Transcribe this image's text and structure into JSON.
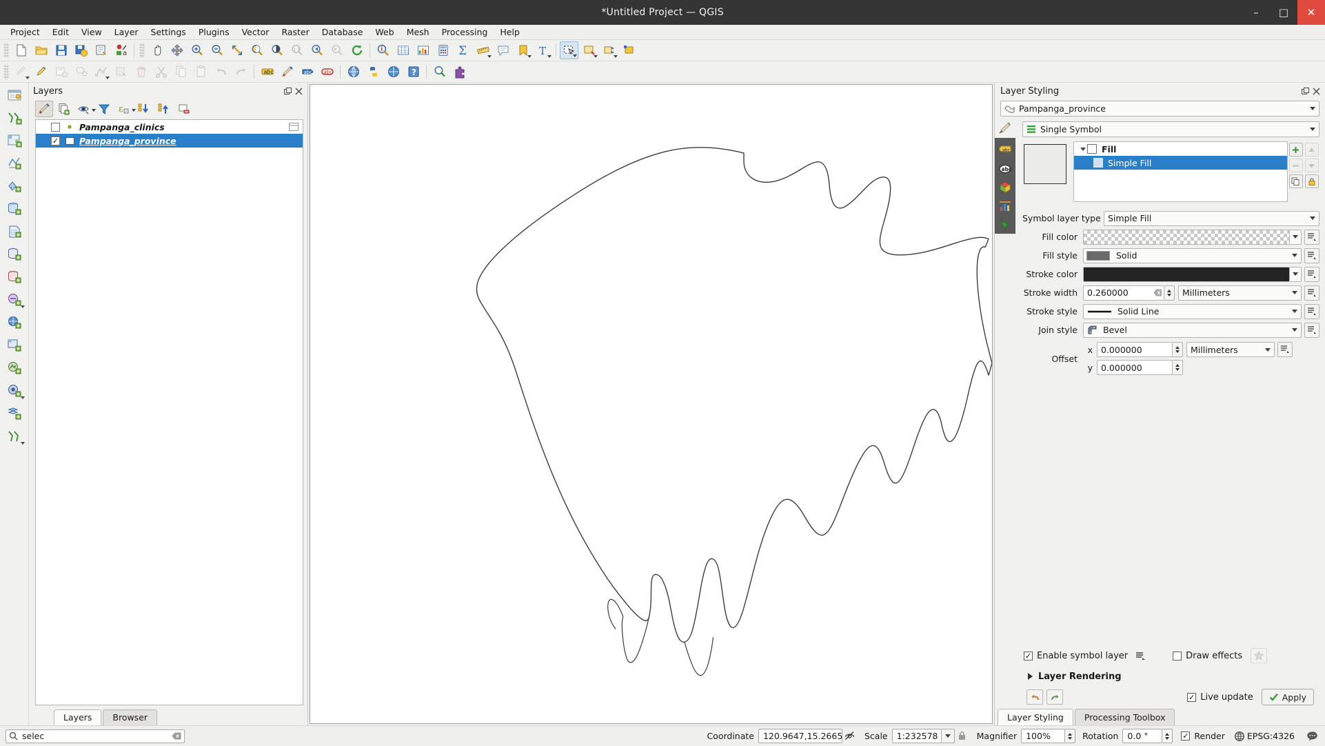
{
  "window": {
    "title": "*Untitled Project — QGIS",
    "minimize": "–",
    "maximize": "□",
    "close": "✕"
  },
  "menubar": {
    "items": [
      {
        "label": "Project"
      },
      {
        "label": "Edit"
      },
      {
        "label": "View"
      },
      {
        "label": "Layer"
      },
      {
        "label": "Settings"
      },
      {
        "label": "Plugins"
      },
      {
        "label": "Vector"
      },
      {
        "label": "Raster"
      },
      {
        "label": "Database"
      },
      {
        "label": "Web"
      },
      {
        "label": "Mesh"
      },
      {
        "label": "Processing"
      },
      {
        "label": "Help"
      }
    ]
  },
  "toolbar_row1": {
    "icons": [
      "new-project-icon",
      "open-project-icon",
      "save-project-icon",
      "save-project-as-icon",
      "new-print-layout-icon",
      "style-manager-icon",
      "pan-map-icon",
      "pan-to-selection-icon",
      "zoom-in-icon",
      "zoom-out-icon",
      "zoom-full-icon",
      "zoom-to-selection-icon",
      "zoom-to-layer-icon",
      "zoom-native-icon",
      "zoom-last-icon",
      "zoom-next-icon",
      "refresh-icon",
      "identify-features-icon",
      "open-attribute-table-icon",
      "statistical-summary-icon",
      "field-calculator-icon",
      "sum-icon",
      "measure-line-icon",
      "map-tips-icon",
      "new-bookmark-icon",
      "text-annotation-icon",
      "select-features-icon",
      "deselect-features-icon",
      "select-value-icon",
      "new-spatial-bookmark-icon"
    ]
  },
  "toolbar_row2": {
    "icons": [
      "current-edits-icon",
      "toggle-editing-icon",
      "save-layer-edits-icon",
      "add-feature-icon",
      "vertex-tool-icon",
      "modify-attributes-icon",
      "delete-selected-icon",
      "cut-features-icon",
      "copy-features-icon",
      "paste-features-icon",
      "undo-icon",
      "redo-icon",
      "label-icon",
      "styling-icon",
      "show-labels-icon",
      "show-pinned-labels-icon",
      "map-globe-icon",
      "python-console-icon",
      "html-help-icon",
      "help-icon",
      "locator-icon",
      "plugin-icon"
    ]
  },
  "left_rail": {
    "icons": [
      "open-data-source-manager-icon",
      "add-vector-layer-icon",
      "add-raster-layer-icon",
      "add-mesh-layer-icon",
      "add-delimited-text-layer-icon",
      "add-postgis-layer-icon",
      "add-spatialite-layer-icon",
      "add-mssql-layer-icon",
      "add-oracle-layer-icon",
      "add-db2-layer-icon",
      "add-wms-layer-icon",
      "add-wcs-layer-icon",
      "add-wfs-layer-icon",
      "add-arcgis-mapserver-layer-icon",
      "add-arcgis-featureserver-layer-icon",
      "add-vectortile-layer-icon",
      "new-shapefile-layer-icon"
    ]
  },
  "layers_panel": {
    "title": "Layers",
    "float_button": "float-panel-icon",
    "close_button": "close-panel-icon",
    "toolbar_icons": [
      "open-layer-styling-panel-icon",
      "add-group-icon",
      "manage-layer-visibility-icon",
      "filter-legend-icon",
      "expression-filter-icon",
      "expand-all-icon",
      "collapse-all-icon",
      "remove-layer-icon"
    ],
    "layers": [
      {
        "name": "Pampanga_clinics",
        "checked": false,
        "selected": false,
        "symbol": "point-symbol",
        "symbol_color": "#8aa32b"
      },
      {
        "name": "Pampanga_province",
        "checked": true,
        "selected": true,
        "symbol": "polygon-symbol",
        "symbol_color": "#ffffff"
      }
    ],
    "tabs": [
      {
        "label": "Layers",
        "selected": true
      },
      {
        "label": "Browser",
        "selected": false
      }
    ]
  },
  "layer_styling": {
    "title": "Layer Styling",
    "float_button": "float-panel-icon",
    "close_button": "close-panel-icon",
    "layer_selector": {
      "value": "Pampanga_province",
      "icon": "polygon-layer-icon"
    },
    "renderer_selector": {
      "value": "Single Symbol",
      "icon": "single-symbol-icon"
    },
    "rail_icons": [
      "symbology-icon",
      "labels-icon",
      "masks-icon",
      "3d-view-icon",
      "diagrams-icon",
      "actions-icon"
    ],
    "symbol_tree": [
      {
        "label": "Fill",
        "level": 0,
        "bold": true,
        "selected": false,
        "expander": true
      },
      {
        "label": "Simple Fill",
        "level": 1,
        "bold": false,
        "selected": true,
        "expander": false
      }
    ],
    "tree_side_buttons": [
      "add-symbol-layer-icon",
      "move-up-icon",
      "remove-symbol-layer-icon",
      "move-down-icon",
      "duplicate-icon",
      "lock-icon"
    ],
    "properties": {
      "symbol_layer_type": {
        "label": "Symbol layer type",
        "value": "Simple Fill"
      },
      "fill_color": {
        "label": "Fill color",
        "value": "transparent",
        "swatch": "checker"
      },
      "fill_style": {
        "label": "Fill style",
        "value": "Solid",
        "swatch": "#696969"
      },
      "stroke_color": {
        "label": "Stroke color",
        "value": "#232323"
      },
      "stroke_width": {
        "label": "Stroke width",
        "value": "0.260000",
        "unit": "Millimeters"
      },
      "stroke_style": {
        "label": "Stroke style",
        "value": "Solid Line"
      },
      "join_style": {
        "label": "Join style",
        "value": "Bevel"
      },
      "offset": {
        "label": "Offset",
        "x_label": "x",
        "x_value": "0.000000",
        "y_label": "y",
        "y_value": "0.000000",
        "unit": "Millimeters"
      }
    },
    "enable_symbol_layer": {
      "label": "Enable symbol layer",
      "checked": true
    },
    "draw_effects": {
      "label": "Draw effects",
      "checked": false,
      "button_icon": "effects-star-icon"
    },
    "layer_rendering": {
      "label": "Layer Rendering",
      "expanded": false
    },
    "undo_icon": "undo-arrow-icon",
    "redo_icon": "redo-arrow-icon",
    "live_update": {
      "label": "Live update",
      "checked": true
    },
    "apply_button": {
      "label": "Apply",
      "icon": "check-icon"
    },
    "tabs": [
      {
        "label": "Layer Styling",
        "selected": true
      },
      {
        "label": "Processing Toolbox",
        "selected": false
      }
    ]
  },
  "statusbar": {
    "search": {
      "value": "selec",
      "icon": "search-icon",
      "clear_icon": "clear-icon"
    },
    "coordinate": {
      "label": "Coordinate",
      "value": "120.9647,15.2665",
      "toggle_icon": "toggle-extents-icon"
    },
    "scale": {
      "label": "Scale",
      "value": "1:232578",
      "lock_icon": "lock-scale-icon"
    },
    "magnifier": {
      "label": "Magnifier",
      "value": "100%"
    },
    "rotation": {
      "label": "Rotation",
      "value": "0.0 °"
    },
    "render": {
      "label": "Render",
      "checked": true
    },
    "crs": {
      "label": "EPSG:4326",
      "icon": "globe-icon"
    },
    "messages_icon": "messages-log-icon"
  },
  "colors": {
    "selection_blue": "#2a7fc9",
    "titlebar_bg": "#353535",
    "panel_bg": "#f0f0ef",
    "close_red": "#e04a3f"
  },
  "map": {
    "feature_name": "Pampanga_province",
    "stroke_color": "#3a3a3a"
  }
}
